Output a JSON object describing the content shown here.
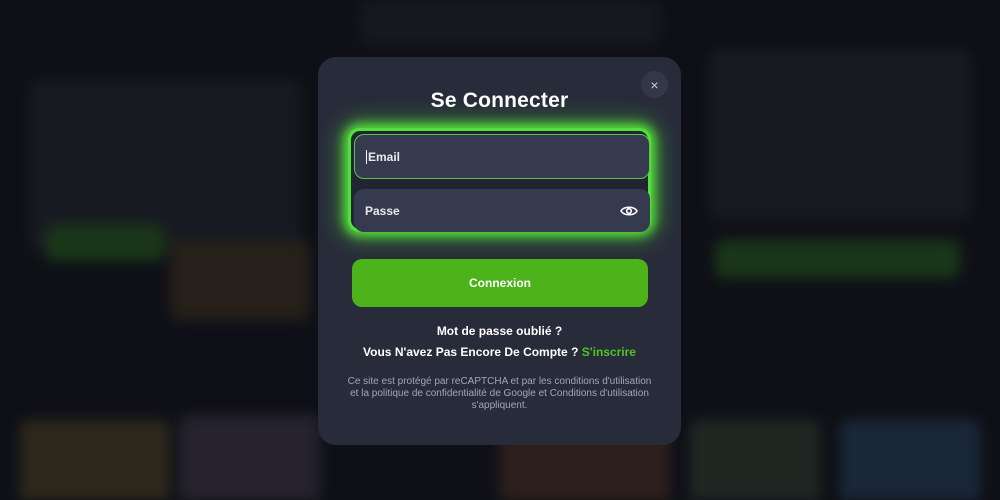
{
  "modal": {
    "title": "Se Connecter",
    "close_icon": "close-icon",
    "close_label": "×",
    "email": {
      "placeholder": "Email"
    },
    "password": {
      "placeholder": "Passe",
      "toggle_icon": "eye-icon"
    },
    "login_button": "Connexion",
    "forgot_password": "Mot de passe oublié ?",
    "no_account": "Vous N'avez Pas Encore De Compte ?",
    "signup_link": "S'inscrire",
    "legal": "Ce site est protégé par reCAPTCHA et par les conditions d'utilisation et la politique de confidentialité de Google et Conditions d'utilisation s'appliquent."
  },
  "colors": {
    "modal_bg": "#282b3a",
    "field_bg": "#363a4f",
    "accent_green": "#4cb31a",
    "glow_green": "#4ee23a",
    "link_green": "#52c226",
    "legal_text": "#a3a6b4"
  }
}
